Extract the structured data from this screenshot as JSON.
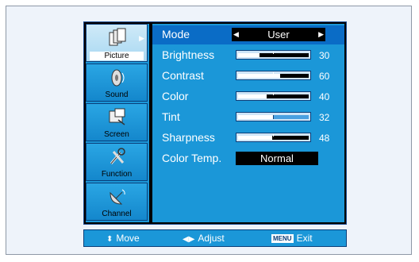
{
  "sidebar": {
    "items": [
      {
        "label": "Picture",
        "icon": "picture-icon",
        "active": true
      },
      {
        "label": "Sound",
        "icon": "speaker-icon",
        "active": false
      },
      {
        "label": "Screen",
        "icon": "screen-icon",
        "active": false
      },
      {
        "label": "Function",
        "icon": "tools-icon",
        "active": false
      },
      {
        "label": "Channel",
        "icon": "satellite-dish-icon",
        "active": false
      }
    ]
  },
  "panel": {
    "mode": {
      "label": "Mode",
      "value": "User"
    },
    "sliders": [
      {
        "label": "Brightness",
        "value": "30",
        "level": 0.3
      },
      {
        "label": "Contrast",
        "value": "60",
        "level": 0.6
      },
      {
        "label": "Color",
        "value": "40",
        "level": 0.4
      },
      {
        "label": "Tint",
        "value": "32",
        "level": 0.32
      },
      {
        "label": "Sharpness",
        "value": "48",
        "level": 0.48
      }
    ],
    "color_temp": {
      "label": "Color Temp.",
      "value": "Normal"
    }
  },
  "footer": {
    "move": "Move",
    "adjust": "Adjust",
    "menu_key": "MENU",
    "exit": "Exit"
  },
  "colors": {
    "panel": "#1b97d8",
    "selected_row": "#0a6cc6",
    "frame_bg": "#eef3fa"
  }
}
